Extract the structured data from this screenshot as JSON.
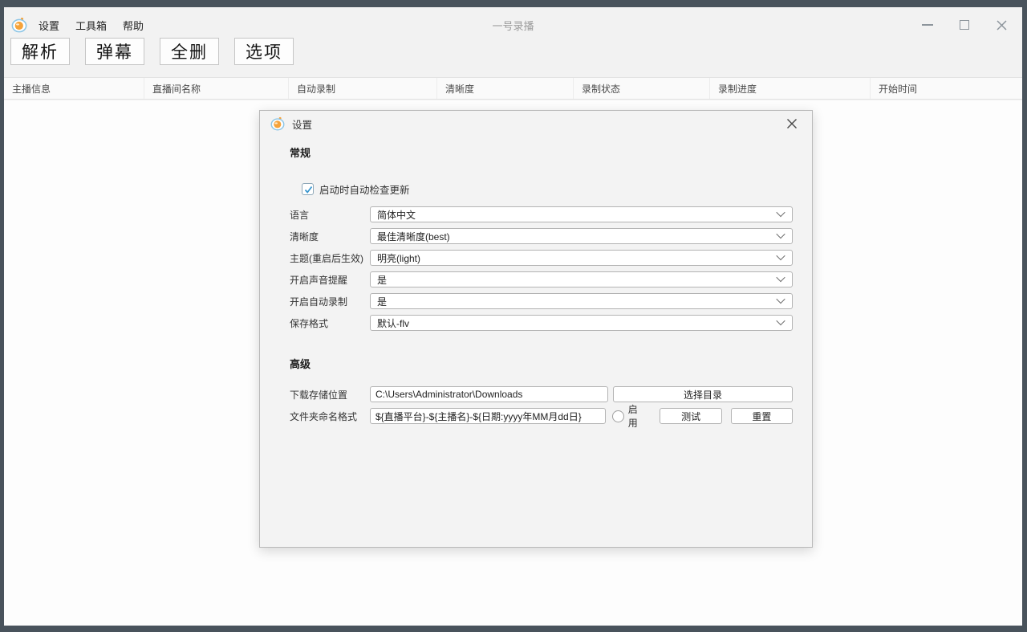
{
  "window": {
    "title": "一号录播",
    "menu": [
      {
        "label": "设置"
      },
      {
        "label": "工具箱"
      },
      {
        "label": "帮助"
      }
    ]
  },
  "toolbar": {
    "buttons": [
      "解析",
      "弹幕",
      "全删",
      "选项"
    ]
  },
  "table": {
    "columns": [
      "主播信息",
      "直播间名称",
      "自动录制",
      "清晰度",
      "录制状态",
      "录制进度",
      "开始时间"
    ],
    "rows": []
  },
  "dialog": {
    "title": "设置",
    "general_section": "常规",
    "advanced_section": "高级",
    "update_checkbox": {
      "label": "启动时自动检查更新",
      "checked": true
    },
    "selects": [
      {
        "label": "语言",
        "value": "简体中文"
      },
      {
        "label": "清晰度",
        "value": "最佳清晰度(best)"
      },
      {
        "label": "主题(重启后生效)",
        "value": "明亮(light)"
      },
      {
        "label": "开启声音提醒",
        "value": "是"
      },
      {
        "label": "开启自动录制",
        "value": "是"
      },
      {
        "label": "保存格式",
        "value": "默认-flv"
      }
    ],
    "download_row": {
      "label": "下载存储位置",
      "value": "C:\\Users\\Administrator\\Downloads",
      "choose_button": "选择目录"
    },
    "format_row": {
      "label": "文件夹命名格式",
      "value": "${直播平台}-${主播名}-${日期:yyyy年MM月dd日}",
      "enable_label": "启用",
      "enabled": false,
      "test_button": "测试",
      "reset_button": "重置"
    }
  },
  "icons": {
    "app": "tv-logo",
    "minimize": "minimize-line",
    "maximize": "square-outline",
    "close": "x-cross",
    "dropdown": "chevron-down",
    "checkbox": "check-mark",
    "radio": "radio-circle"
  },
  "colors": {
    "frame": "#49535c",
    "window_bg": "#f2f2f2",
    "body_bg": "#fdfdfd",
    "dialog_bg": "#f3f3f3",
    "control_border": "#b3b3b3",
    "check_accent": "#3a97cf",
    "icon_orange": "#f5a33b",
    "icon_blue": "#8ec6e6",
    "title_text": "#9b9b9b"
  }
}
